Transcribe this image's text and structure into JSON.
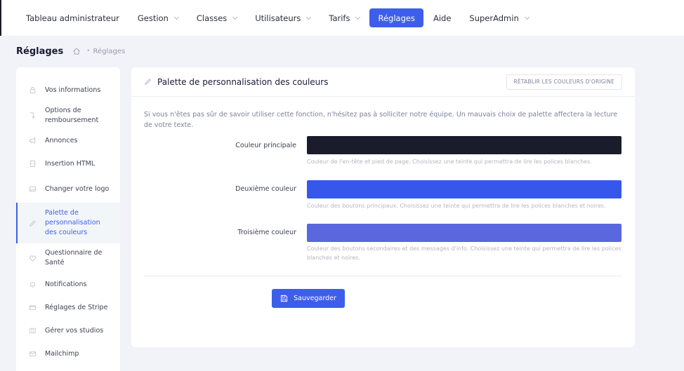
{
  "topnav": {
    "items": [
      {
        "label": "Tableau administrateur",
        "has_dropdown": false,
        "active": false
      },
      {
        "label": "Gestion",
        "has_dropdown": true,
        "active": false
      },
      {
        "label": "Classes",
        "has_dropdown": true,
        "active": false
      },
      {
        "label": "Utilisateurs",
        "has_dropdown": true,
        "active": false
      },
      {
        "label": "Tarifs",
        "has_dropdown": true,
        "active": false
      },
      {
        "label": "Réglages",
        "has_dropdown": false,
        "active": true
      },
      {
        "label": "Aide",
        "has_dropdown": false,
        "active": false
      },
      {
        "label": "SuperAdmin",
        "has_dropdown": true,
        "active": false
      }
    ]
  },
  "subheader": {
    "title": "Réglages",
    "breadcrumb_icon": "home-icon",
    "breadcrumb": "Réglages"
  },
  "sidebar": {
    "items": [
      {
        "label": "Vos informations",
        "icon": "lock-icon"
      },
      {
        "label": "Options de remboursement",
        "icon": "return-arrow-icon"
      },
      {
        "label": "Annonces",
        "icon": "megaphone-icon"
      },
      {
        "label": "Insertion HTML",
        "icon": "file-code-icon"
      },
      {
        "label": "Changer votre logo",
        "icon": "image-icon"
      },
      {
        "label": "Palette de personnalisation des couleurs",
        "icon": "pencil-icon",
        "active": true
      },
      {
        "label": "Questionnaire de Santé",
        "icon": "heart-icon"
      },
      {
        "label": "Notifications",
        "icon": "bell-icon"
      },
      {
        "label": "Réglages de Stripe",
        "icon": "credit-card-icon"
      },
      {
        "label": "Gérer vos studios",
        "icon": "map-icon"
      },
      {
        "label": "Mailchimp",
        "icon": "mail-icon"
      }
    ]
  },
  "card": {
    "title": "Palette de personnalisation des couleurs",
    "title_icon": "pencil-icon",
    "reset_label": "RÉTABLIR LES COULEURS D'ORIGINE",
    "intro": "Si vous n'êtes pas sûr de savoir utiliser cette fonction, n'hésitez pas à solliciter notre équipe. Un mauvais choix de palette affectera la lecture de votre texte.",
    "colors": [
      {
        "label": "Couleur principale",
        "value": "#1b1c2b",
        "hint": "Couleur de l'en-tête et pied de page. Choisissez une teinte qui permettra de lire les polices blanches."
      },
      {
        "label": "Deuxième couleur",
        "value": "#3558ea",
        "hint": "Couleur des boutons principaux. Choisissez une teinte qui permettra de lire les polices blanches et noires."
      },
      {
        "label": "Troisième couleur",
        "value": "#5a67de",
        "hint": "Couleur des boutons secondaires et des messages d'info. Choisissez une teinte qui permettra de lire les polices blanches et noires."
      }
    ],
    "save_label": "Sauvegarder",
    "save_icon": "floppy-disk-icon"
  }
}
